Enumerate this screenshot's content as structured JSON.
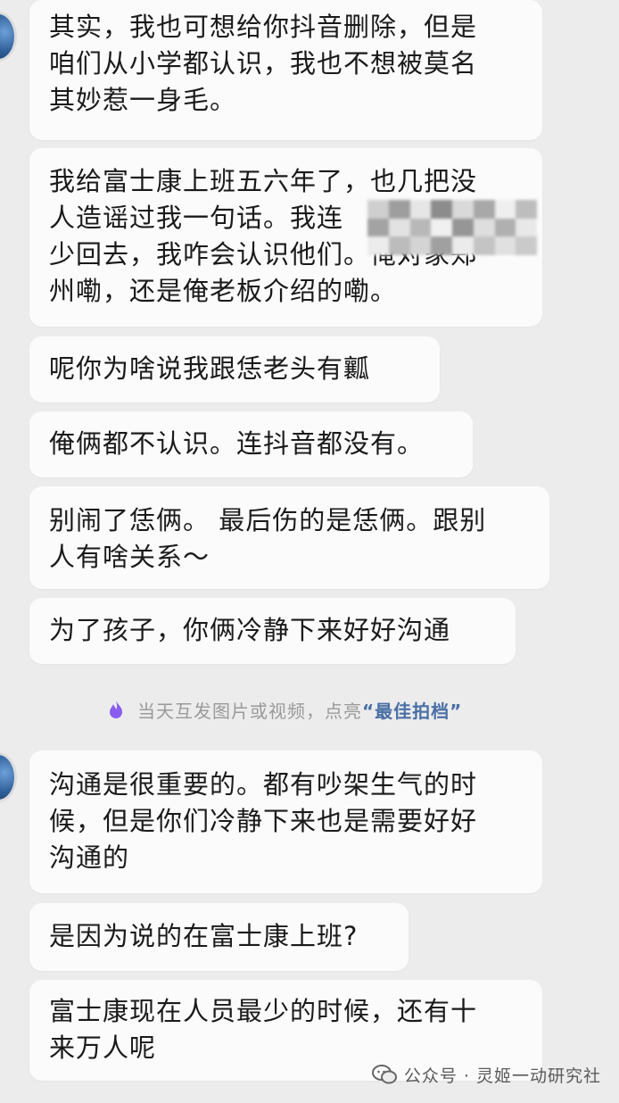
{
  "messages": [
    {
      "text": "其实，我也可想给你抖音删除，但是\n咱们从小学都认识，我也不想被莫名\n其妙惹一身毛。"
    },
    {
      "text": "我给富士康上班五六年了，也几把没\n人造谣过我一句话。我连\n少回去，我咋会认识他们。俺对家郑\n州嘞，还是俺老板介绍的嘞。"
    },
    {
      "text": "呢你为啥说我跟恁老头有瓤"
    },
    {
      "text": "俺俩都不认识。连抖音都没有。"
    },
    {
      "text": "别闹了恁俩。 最后伤的是恁俩。跟别\n人有啥关系～"
    },
    {
      "text": "为了孩子，你俩冷静下来好好沟通"
    },
    {
      "text": "沟通是很重要的。都有吵架生气的时\n候，但是你们冷静下来也是需要好好\n沟通的"
    },
    {
      "text": "是因为说的在富士康上班?"
    },
    {
      "text": "富士康现在人员最少的时候，还有十\n来万人呢"
    }
  ],
  "notice": {
    "text": "当天互发图片或视频，点亮",
    "highlight": "“最佳拍档”"
  },
  "watermark": {
    "text": "公众号 · 灵姬一动研究社"
  },
  "colors": {
    "background": "#ececec",
    "bubble": "#fbfbfb",
    "text": "#1a1a1a",
    "notice_text": "#9a9a9a",
    "highlight": "#4a6fa5",
    "notice_icon": "#8a5cf0"
  },
  "icons": {
    "notice": "flame-icon",
    "watermark": "wechat-icon",
    "avatar": "user-avatar"
  }
}
